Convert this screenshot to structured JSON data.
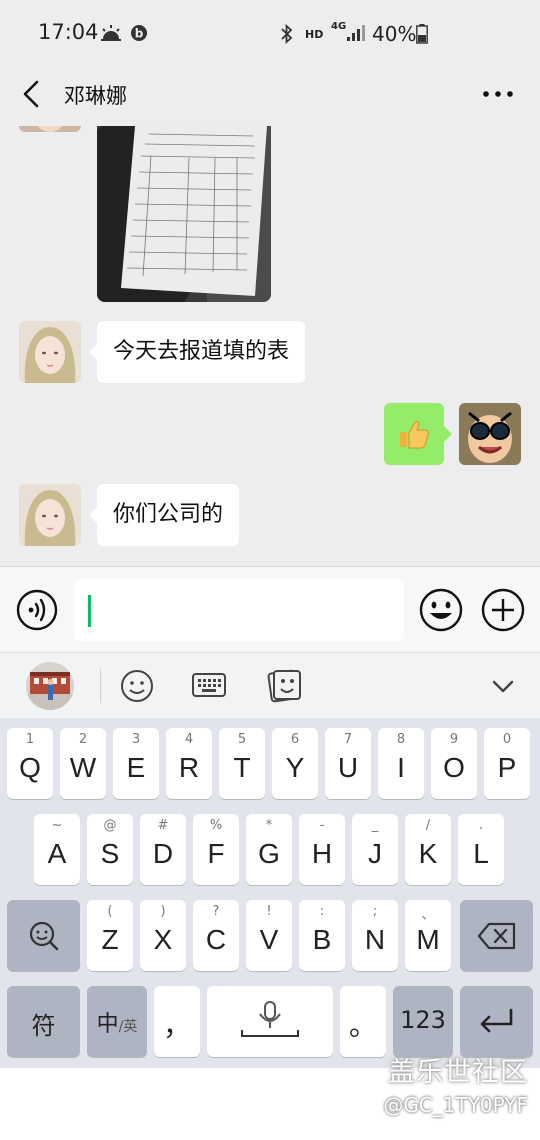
{
  "status_bar": {
    "time": "17:04",
    "hd": "HD",
    "network": "4G",
    "battery": "40%"
  },
  "header": {
    "title": "邓琳娜"
  },
  "messages": [
    {
      "side": "in",
      "type": "image"
    },
    {
      "side": "in",
      "type": "text",
      "text": "今天去报道填的表"
    },
    {
      "side": "out",
      "type": "emoji",
      "emoji": "👍"
    },
    {
      "side": "in",
      "type": "text",
      "text": "你们公司的"
    }
  ],
  "input": {
    "value": "",
    "placeholder": ""
  },
  "keyboard": {
    "row1": [
      {
        "main": "Q",
        "sub": "1"
      },
      {
        "main": "W",
        "sub": "2"
      },
      {
        "main": "E",
        "sub": "3"
      },
      {
        "main": "R",
        "sub": "4"
      },
      {
        "main": "T",
        "sub": "5"
      },
      {
        "main": "Y",
        "sub": "6"
      },
      {
        "main": "U",
        "sub": "7"
      },
      {
        "main": "I",
        "sub": "8"
      },
      {
        "main": "O",
        "sub": "9"
      },
      {
        "main": "P",
        "sub": "0"
      }
    ],
    "row2": [
      {
        "main": "A",
        "sub": "~"
      },
      {
        "main": "S",
        "sub": "@"
      },
      {
        "main": "D",
        "sub": "#"
      },
      {
        "main": "F",
        "sub": "%"
      },
      {
        "main": "G",
        "sub": "*"
      },
      {
        "main": "H",
        "sub": "-"
      },
      {
        "main": "J",
        "sub": "_"
      },
      {
        "main": "K",
        "sub": "/"
      },
      {
        "main": "L",
        "sub": "."
      }
    ],
    "row3": [
      {
        "main": "Z",
        "sub": "("
      },
      {
        "main": "X",
        "sub": ")"
      },
      {
        "main": "C",
        "sub": "?"
      },
      {
        "main": "V",
        "sub": "!"
      },
      {
        "main": "B",
        "sub": ":"
      },
      {
        "main": "N",
        "sub": ";"
      },
      {
        "main": "M",
        "sub": "、"
      }
    ],
    "symbol_label": "符",
    "lang_label": "中",
    "lang_alt": "/英",
    "comma": "，",
    "period": "。",
    "num_label": "123"
  },
  "watermark": {
    "line1": "盖乐世社区",
    "line2": "@GC_1TY0PYF"
  },
  "colors": {
    "accent_green": "#07c160",
    "out_bubble": "#95ec69",
    "background": "#ededed"
  }
}
